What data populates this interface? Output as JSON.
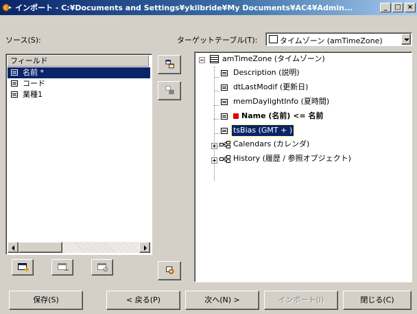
{
  "window": {
    "title": "インポート - C:¥Documents and Settings¥ykilbride¥My Documents¥AC4¥Admin...",
    "min_symbol": "_",
    "max_symbol": "□",
    "close_symbol": "×"
  },
  "source": {
    "label": "ソース(S):",
    "header": "フィールド",
    "fields": [
      {
        "label": "名前 *",
        "selected": true
      },
      {
        "label": "コード",
        "selected": false
      },
      {
        "label": "業種1",
        "selected": false
      }
    ]
  },
  "target": {
    "label": "ターゲットテーブル(T):",
    "selected_table": "タイムゾーン (amTimeZone)",
    "tree": [
      {
        "label": "amTimeZone (タイムゾーン)",
        "kind": "table-root"
      },
      {
        "label": "Description (説明)",
        "kind": "field"
      },
      {
        "label": "dtLastModif (更新日)",
        "kind": "field"
      },
      {
        "label": "memDaylightInfo (夏時間)",
        "kind": "field"
      },
      {
        "label": "Name (名前) <=  名前",
        "kind": "field-mapped"
      },
      {
        "label": "tsBias (GMT + )",
        "kind": "field-selected"
      },
      {
        "label": "Calendars (カレンダ)",
        "kind": "link"
      },
      {
        "label": "History (履歴 / 参照オブジェクト)",
        "kind": "link"
      }
    ]
  },
  "buttons": {
    "save": "保存(S)",
    "back": "< 戻る(P)",
    "next": "次へ(N) >",
    "import": "インポート(I)",
    "close": "閉じる(C)"
  },
  "colors": {
    "title_start": "#0a246a",
    "selection": "#0a246a",
    "mapped_marker": "#e00000",
    "face": "#d4d0c8"
  }
}
